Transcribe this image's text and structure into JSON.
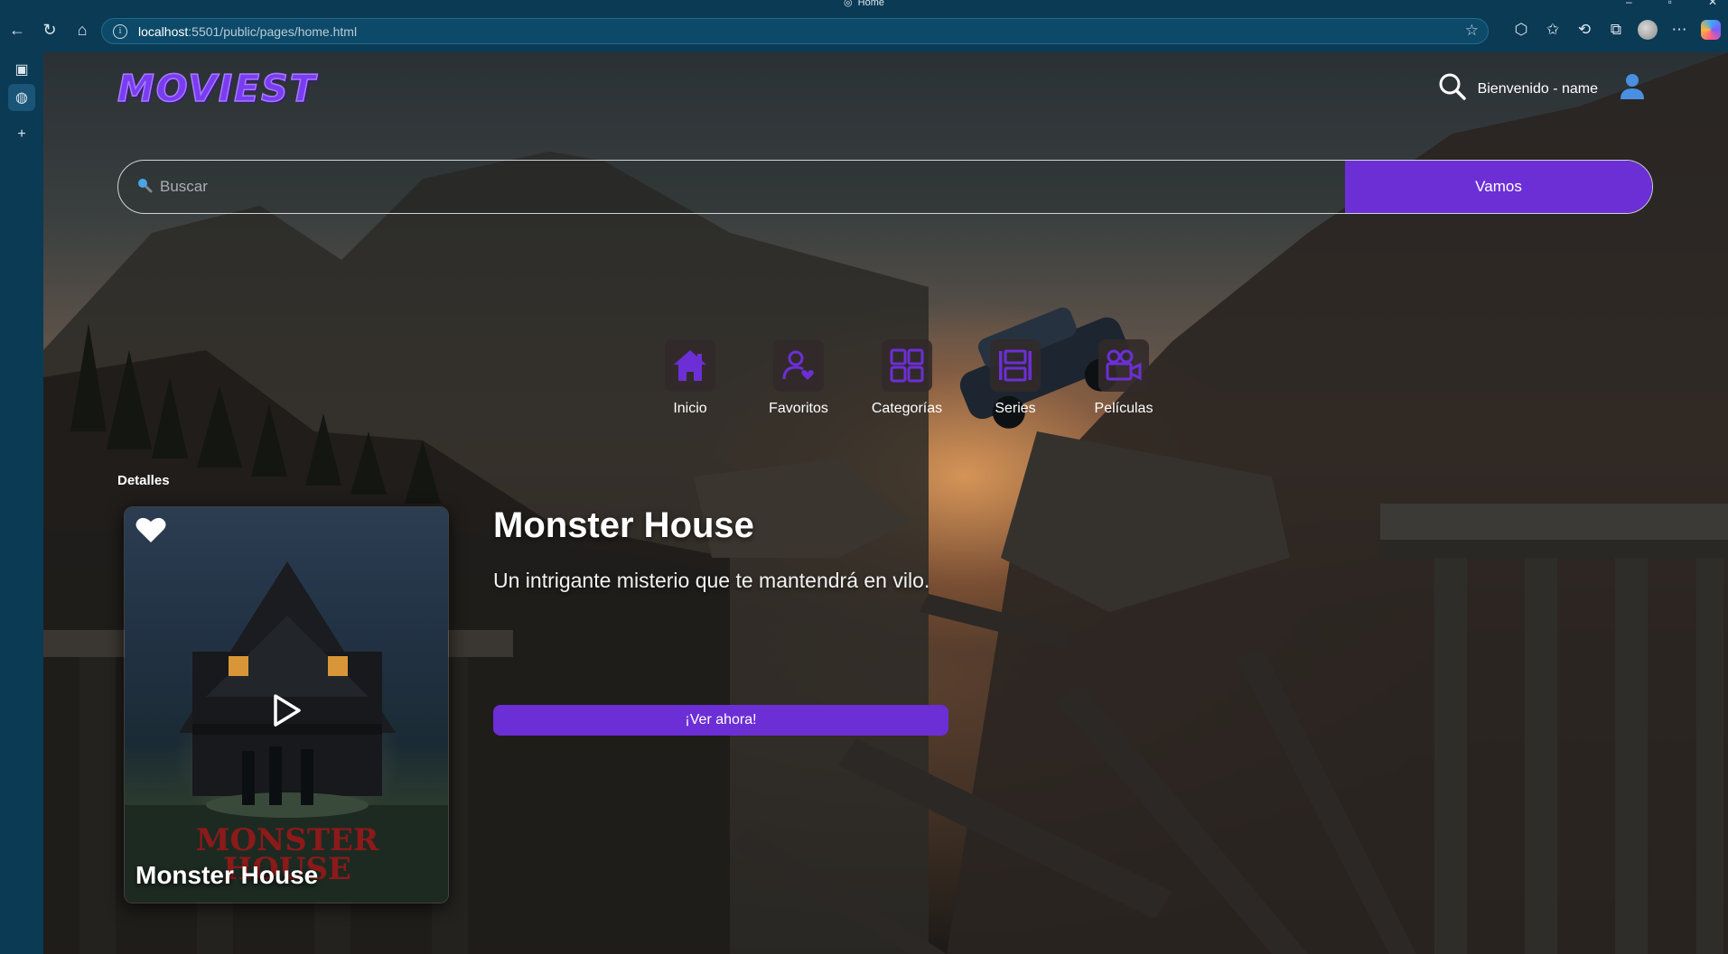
{
  "browser": {
    "tab_title": "Home",
    "url_host": "localhost",
    "url_rest": ":5501/public/pages/home.html"
  },
  "app": {
    "logo_text": "MOVIEST",
    "welcome_text": "Bienvenido - name"
  },
  "search": {
    "placeholder": "Buscar",
    "button_label": "Vamos"
  },
  "nav": {
    "items": [
      {
        "label": "Inicio",
        "icon": "home-icon"
      },
      {
        "label": "Favoritos",
        "icon": "user-heart-icon"
      },
      {
        "label": "Categorías",
        "icon": "grid-icon"
      },
      {
        "label": "Series",
        "icon": "series-icon"
      },
      {
        "label": "Películas",
        "icon": "movie-camera-icon"
      }
    ]
  },
  "section": {
    "title": "Detalles"
  },
  "movie": {
    "poster_title": "Monster House",
    "title": "Monster House",
    "description": "Un intrigante misterio que te mantendrá en vilo.",
    "watch_label": "¡Ver ahora!"
  },
  "colors": {
    "accent": "#6c2fd6",
    "chrome": "#0b3a55"
  }
}
